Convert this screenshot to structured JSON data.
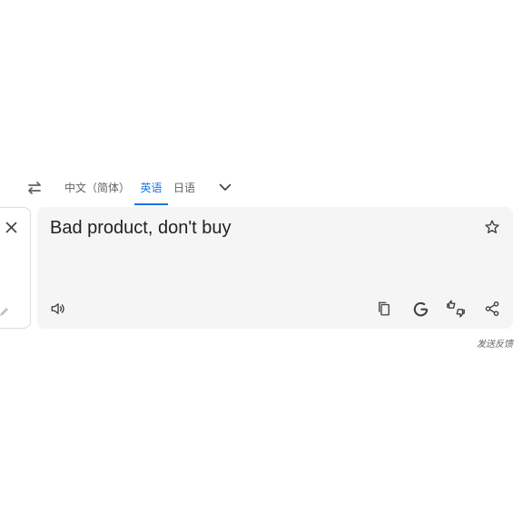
{
  "languages": {
    "target_tabs": [
      {
        "label": "中文（简体）",
        "active": false
      },
      {
        "label": "英语",
        "active": true
      },
      {
        "label": "日语",
        "active": false
      }
    ]
  },
  "translation": {
    "text": "Bad product, don't buy"
  },
  "footer": {
    "feedback_label": "发送反馈"
  },
  "icons": {
    "swap": "swap-arrows-icon",
    "more": "chevron-down-icon",
    "clear": "close-icon",
    "edit": "pencil-icon",
    "star": "star-outline-icon",
    "listen": "speaker-icon",
    "copy": "copy-icon",
    "google": "google-g-icon",
    "rate": "thumbs-rate-icon",
    "share": "share-icon"
  },
  "colors": {
    "accent": "#1a73e8",
    "panel_bg": "#f5f5f5",
    "icon": "#5f6368",
    "text": "#202124"
  }
}
